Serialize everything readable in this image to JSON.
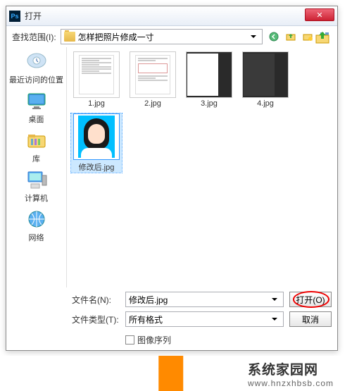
{
  "window": {
    "title": "打开"
  },
  "lookIn": {
    "label": "查找范围(I):",
    "value": "怎样把照片修成一寸"
  },
  "sidebar": [
    {
      "label": "最近访问的位置",
      "icon": "recent"
    },
    {
      "label": "桌面",
      "icon": "desktop"
    },
    {
      "label": "库",
      "icon": "library"
    },
    {
      "label": "计算机",
      "icon": "computer"
    },
    {
      "label": "网络",
      "icon": "network"
    }
  ],
  "files": [
    {
      "name": "1.jpg",
      "thumb": "doc",
      "selected": false
    },
    {
      "name": "2.jpg",
      "thumb": "doc-box",
      "selected": false
    },
    {
      "name": "3.jpg",
      "thumb": "ps-light",
      "selected": false
    },
    {
      "name": "4.jpg",
      "thumb": "ps-dark",
      "selected": false
    },
    {
      "name": "修改后.jpg",
      "thumb": "portrait",
      "selected": true
    }
  ],
  "fields": {
    "filenameLabel": "文件名(N):",
    "filenameValue": "修改后.jpg",
    "filetypeLabel": "文件类型(T):",
    "filetypeValue": "所有格式",
    "sequenceLabel": "图像序列"
  },
  "buttons": {
    "open": "打开(O)",
    "cancel": "取消"
  },
  "watermark": {
    "brand": "系统家园网",
    "url": "www.hnzxhbsb.com"
  }
}
